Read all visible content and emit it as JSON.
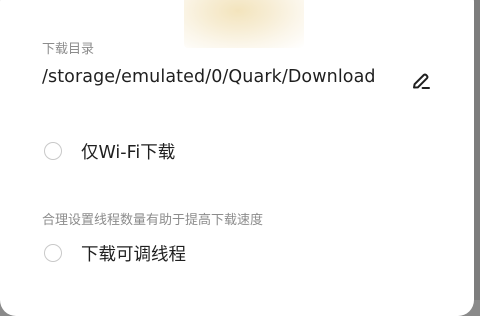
{
  "download_dir": {
    "label": "下载目录",
    "path": "/storage/emulated/0/Quark/Download",
    "edit_icon": "pencil-edit-icon"
  },
  "wifi_only": {
    "label": "仅Wi-Fi下载",
    "checked": false
  },
  "threads": {
    "hint": "合理设置线程数量有助于提高下载速度",
    "label": "下载可调线程",
    "checked": false
  },
  "colors": {
    "text_primary": "#1f1f1f",
    "text_secondary": "#8c8c8c",
    "radio_border": "#c9c9c9"
  }
}
